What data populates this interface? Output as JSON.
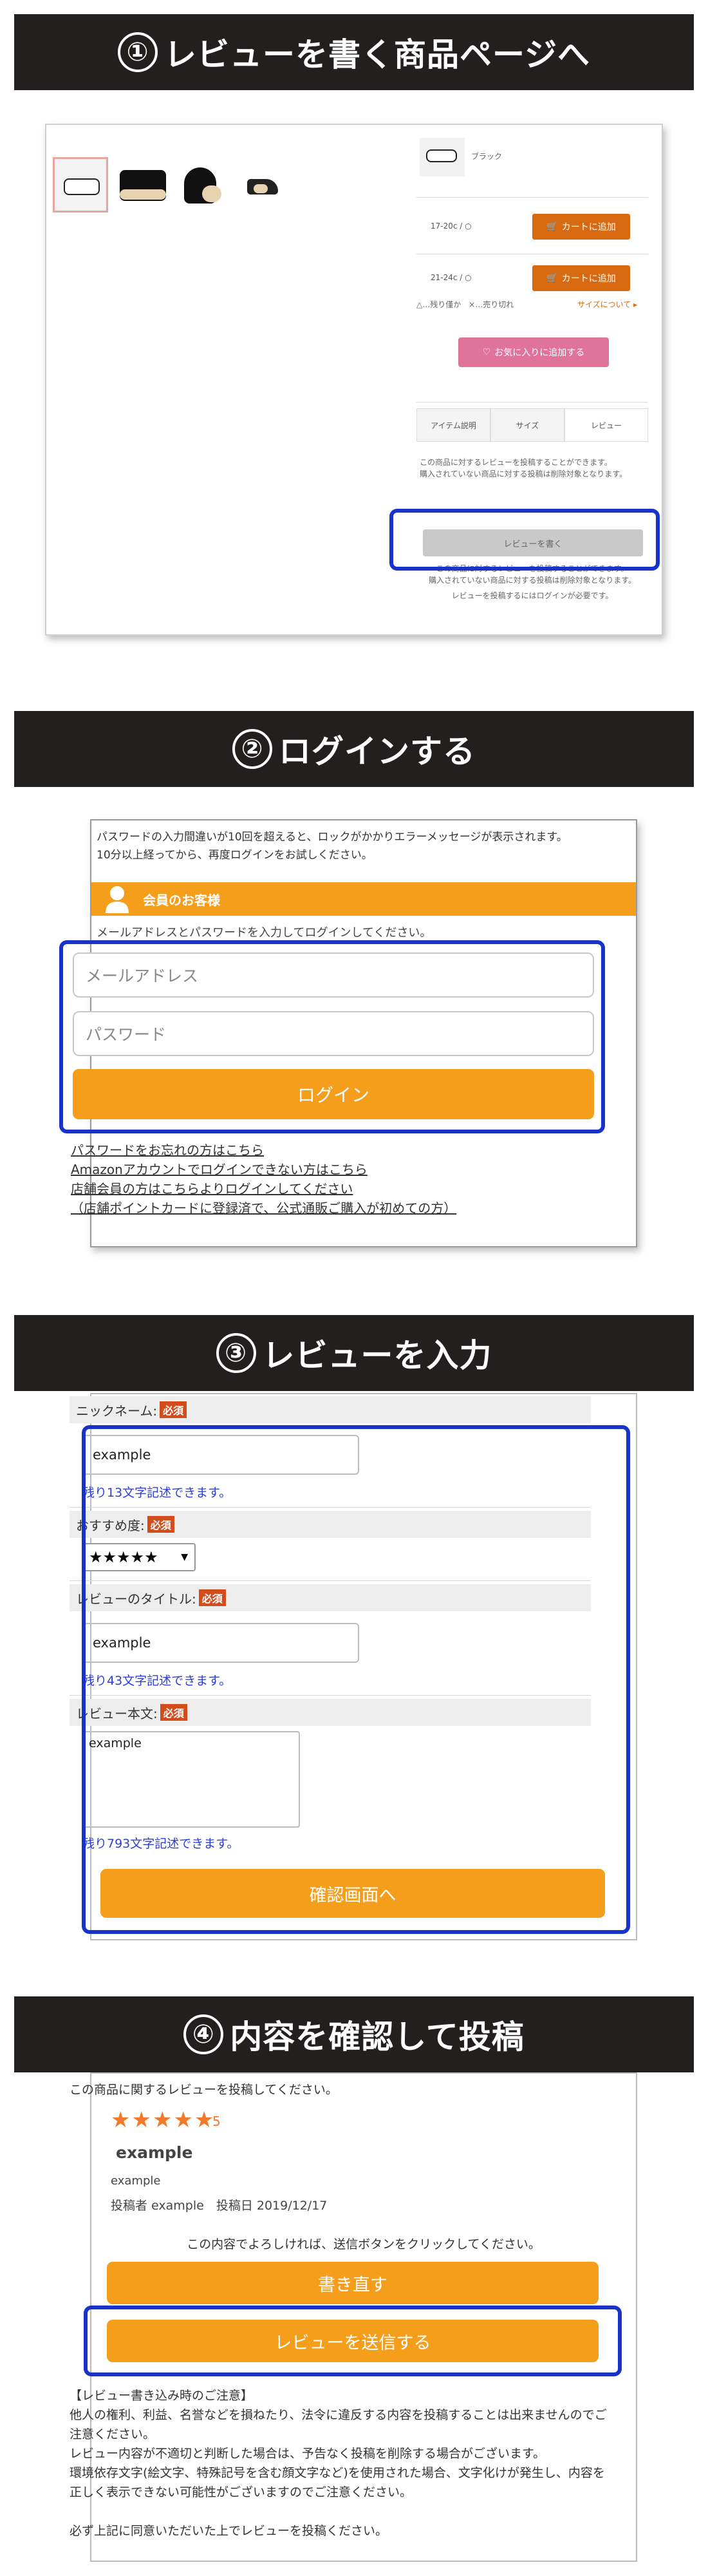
{
  "steps": {
    "s1": {
      "num": "①",
      "title": "レビューを書く商品ページへ"
    },
    "s2": {
      "num": "②",
      "title": "ログインする"
    },
    "s3": {
      "num": "③",
      "title": "レビューを入力"
    },
    "s4": {
      "num": "④",
      "title": "内容を確認して投稿"
    }
  },
  "product": {
    "color_label": "ブラック",
    "sizes": [
      {
        "label": "17-20c / ○",
        "button": "カートに追加"
      },
      {
        "label": "21-24c / ○",
        "button": "カートに追加"
      }
    ],
    "stock_legend": "△…残り僅か　×…売り切れ",
    "size_link": "サイズについて ▸",
    "favorite_button": "お気に入りに追加する",
    "tabs": [
      "アイテム説明",
      "サイズ",
      "レビュー"
    ],
    "review_notice": "この商品に対するレビューを投稿することができます。\n購入されていない商品に対する投稿は削除対象となります。",
    "write_review_button": "レビューを書く",
    "review_notice_2": "この商品に対するレビューを投稿することができます。\n購入されていない商品に対する投稿は削除対象となります。",
    "login_required": "レビューを投稿するにはログインが必要です。"
  },
  "login": {
    "warning": "パスワードの入力間違いが10回を超えると、ロックがかかりエラーメッセージが表示されます。\n10分以上経ってから、再度ログインをお試しください。",
    "section_title": "会員のお客様",
    "instruction": "メールアドレスとパスワードを入力してログインしてください。",
    "email_placeholder": "メールアドレス",
    "password_placeholder": "パスワード",
    "login_button": "ログイン",
    "links": [
      "パスワードをお忘れの方はこちら",
      "Amazonアカウントでログインできない方はこちら",
      "店舗会員の方はこちらよりログインしてください",
      "（店舗ポイントカードに登録済で、公式通販ご購入が初めての方）"
    ]
  },
  "review_form": {
    "nickname_label": "ニックネーム:",
    "required": "必須",
    "nickname_value": "example",
    "nickname_remain": "残り13文字記述できます。",
    "rating_label": "おすすめ度:",
    "rating_value": "★★★★★",
    "title_label": "レビューのタイトル:",
    "title_value": "example",
    "title_remain": "残り43文字記述できます。",
    "body_label": "レビュー本文:",
    "body_value": "example",
    "body_remain": "残り793文字記述できます。",
    "confirm_button": "確認画面へ"
  },
  "confirm": {
    "intro": "この商品に関するレビューを投稿してください。",
    "stars": "★★★★★",
    "score": "5",
    "title": "example",
    "body": "example",
    "meta": "投稿者 example　投稿日 2019/12/17",
    "prompt": "この内容でよろしければ、送信ボタンをクリックしてください。",
    "rewrite_button": "書き直す",
    "submit_button": "レビューを送信する",
    "notice": "【レビュー書き込み時のご注意】\n他人の権利、利益、名誉などを損ねたり、法令に違反する内容を投稿することは出来ませんのでご注意ください。\nレビュー内容が不適切と判断した場合は、予告なく投稿を削除する場合がございます。\n環境依存文字(絵文字、特殊記号を含む顔文字など)を使用された場合、文字化けが発生し、内容を正しく表示できない可能性がございますのでご注意ください。\n\n必ず上記に同意いただいた上でレビューを投稿ください。"
  },
  "colors": {
    "banner": "#231f1f",
    "highlight": "#1733c9",
    "orange": "#f59e1c",
    "cart": "#d86b12",
    "favorite": "#e0739a",
    "star": "#f07a2a",
    "required_badge": "#d24c1c"
  }
}
